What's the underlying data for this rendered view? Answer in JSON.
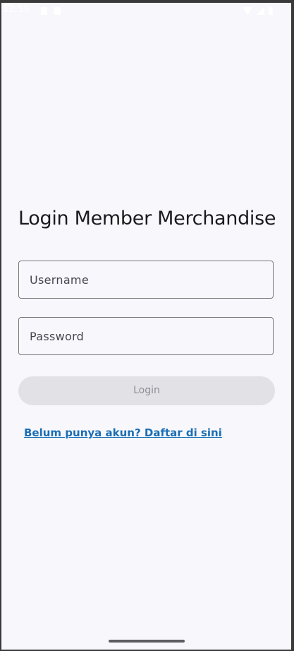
{
  "status_bar": {
    "time": "12:59",
    "left_icons": [
      "app-notification-icon",
      "app-notification-icon"
    ],
    "right_icons": [
      "wifi-icon",
      "signal-icon",
      "battery-icon"
    ]
  },
  "login_form": {
    "title": "Login Member Merchandise",
    "username_placeholder": "Username",
    "username_value": "",
    "password_placeholder": "Password",
    "password_value": "",
    "login_button_label": "Login",
    "register_link_text": "Belum punya akun? Daftar di sini"
  },
  "colors": {
    "background": "#f8f7fc",
    "link": "#1a6fb5",
    "button_disabled_bg": "#e2e1e6",
    "button_disabled_text": "#8e8d93"
  }
}
